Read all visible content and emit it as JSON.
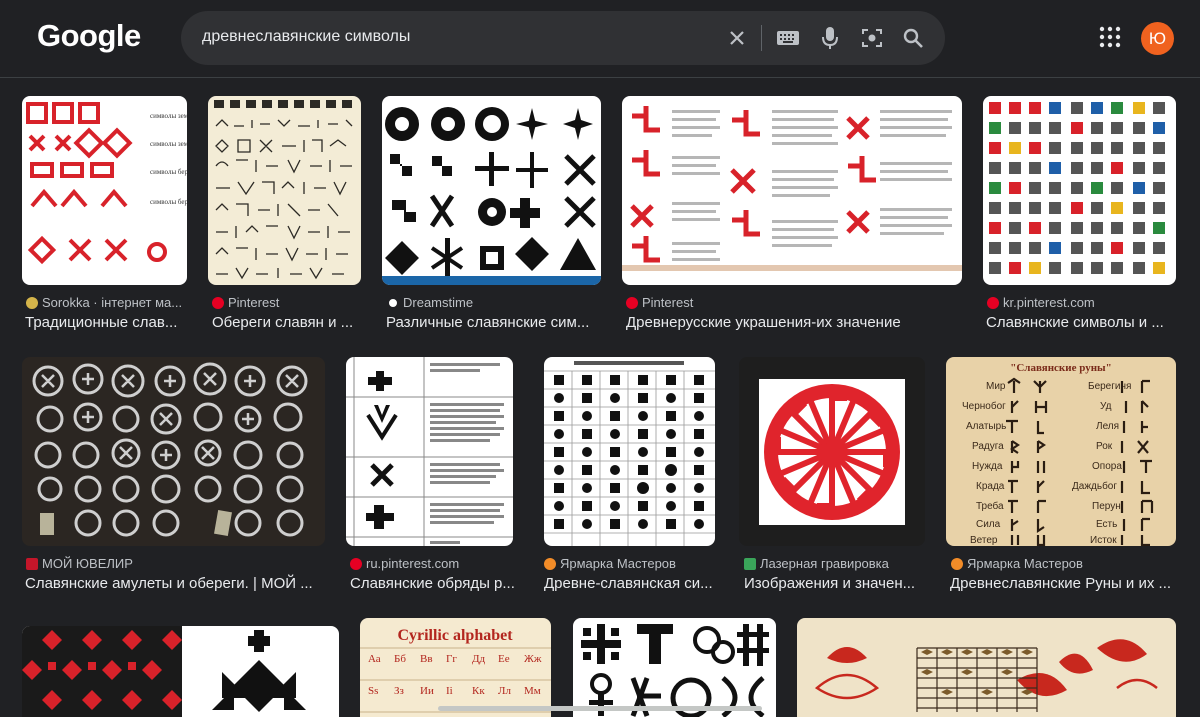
{
  "header": {
    "logo": "Google",
    "query": "древнеславянские символы",
    "avatar_letter": "Ю",
    "accent": "#f0621f"
  },
  "results": [
    {
      "source": "Sorokka · інтернет ма...",
      "title": "Традиционные слав...",
      "favicon_color": "#d4b44a",
      "thumb_labels": [
        "символы земли",
        "символы земли",
        "символы берегиь",
        "символы берегиь рода"
      ]
    },
    {
      "source": "Pinterest",
      "title": "Обереги славян и ...",
      "favicon_color": "#e60023"
    },
    {
      "source": "Dreamstime",
      "title": "Различные славянские сим...",
      "favicon_color": "#1c1c1c"
    },
    {
      "source": "Pinterest",
      "title": "Древнерусские украшения-их значение",
      "favicon_color": "#e60023"
    },
    {
      "source": "kr.pinterest.com",
      "title": "Славянские символы и ...",
      "favicon_color": "#e60023"
    },
    {
      "source": "МОЙ ЮВЕЛИР",
      "title": "Славянские амулеты и обереги. | МОЙ ...",
      "favicon_color": "#c4162a"
    },
    {
      "source": "ru.pinterest.com",
      "title": "Славянские обряды р...",
      "favicon_color": "#e60023"
    },
    {
      "source": "Ярмарка Мастеров",
      "title": "Древне-славянская си...",
      "favicon_color": "#f28c28"
    },
    {
      "source": "Лазерная гравировка",
      "title": "Изображения и значен...",
      "favicon_color": "#3aa55a"
    },
    {
      "source": "Ярмарка Мастеров",
      "title": "Древнеславянские Руны и их ...",
      "favicon_color": "#f28c28",
      "thumb_title": "\"Славянские руны\"",
      "thumb_runes": [
        "Мир",
        "Берегиня",
        "Чернобог",
        "Уд",
        "Алатырь",
        "Леля",
        "Радуга",
        "Рок",
        "Нужда",
        "Опора",
        "Крада",
        "Даждьбог",
        "Треба",
        "Перун",
        "Сила",
        "Есть",
        "Ветер",
        "Исток"
      ]
    },
    {
      "source": "",
      "title": ""
    },
    {
      "source": "",
      "title": "",
      "thumb_title": "Cyrillic alphabet",
      "thumb_letters": [
        "Аа",
        "Бб",
        "Вв",
        "Гг",
        "Дд",
        "Ее",
        "Жж",
        "Ѕѕ",
        "Зз",
        "Ии",
        "Іі",
        "Кк",
        "Лл",
        "Мм"
      ]
    },
    {
      "source": "",
      "title": ""
    },
    {
      "source": "",
      "title": ""
    }
  ]
}
